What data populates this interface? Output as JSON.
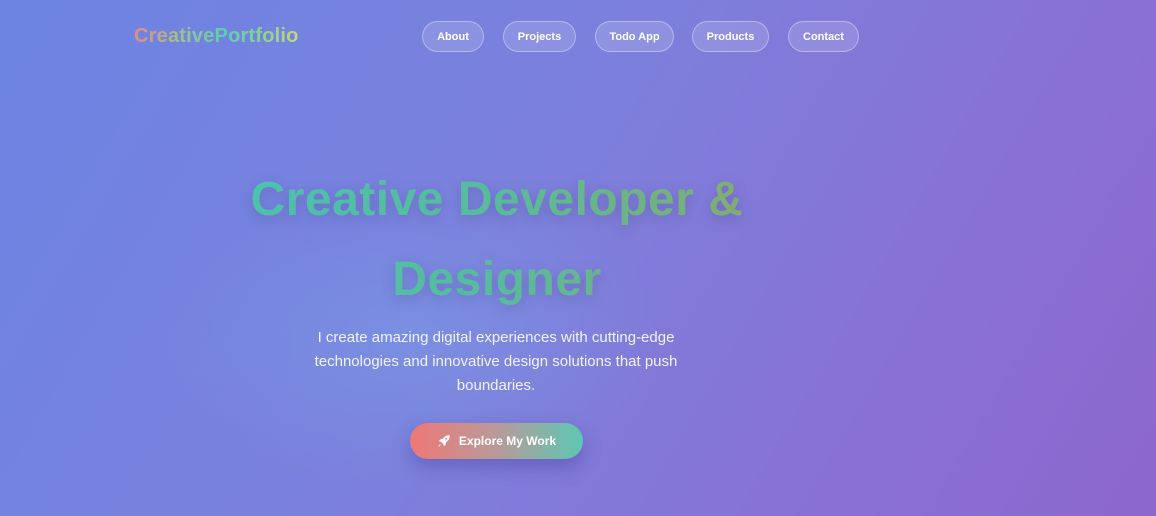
{
  "brand": {
    "logo_text": "CreativePortfolio"
  },
  "nav": {
    "items": [
      {
        "label": "About"
      },
      {
        "label": "Projects"
      },
      {
        "label": "Todo App"
      },
      {
        "label": "Products"
      },
      {
        "label": "Contact"
      }
    ]
  },
  "hero": {
    "title_line1": "Creative Developer &",
    "title_line2": "Designer",
    "subtitle": "I create amazing digital experiences with cutting-edge technologies and innovative design solutions that push boundaries.",
    "cta": {
      "label": "Explore My Work",
      "icon": "rocket-icon"
    }
  },
  "colors": {
    "background_start": "#6d84e3",
    "background_end": "#8c67cd",
    "title_gradient_start": "#49c3b0",
    "title_gradient_end": "#8aa96a",
    "cta_gradient_start": "#ee7777",
    "cta_gradient_end": "#5bc8b2"
  }
}
